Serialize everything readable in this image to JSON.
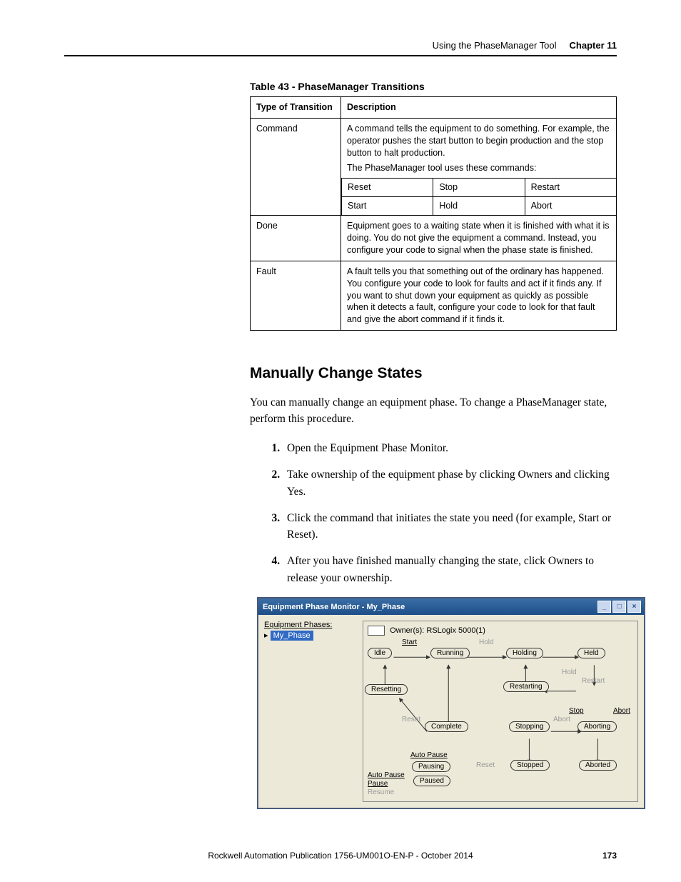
{
  "header": {
    "section": "Using the PhaseManager Tool",
    "chapter": "Chapter 11"
  },
  "table": {
    "caption": "Table 43 - PhaseManager Transitions",
    "head": {
      "c1": "Type of Transition",
      "c2": "Description"
    },
    "rows": {
      "command": {
        "type": "Command",
        "p1": "A command tells the equipment to do something. For example, the operator pushes the start button to begin production and the stop button to halt production.",
        "p2": "The PhaseManager tool uses these commands:",
        "cmds": [
          "Reset",
          "Stop",
          "Restart",
          "Start",
          "Hold",
          "Abort"
        ]
      },
      "done": {
        "type": "Done",
        "desc": "Equipment goes to a waiting state when it is finished with what it is doing. You do not give the equipment a command. Instead, you configure your code to signal when the phase state is finished."
      },
      "fault": {
        "type": "Fault",
        "desc": "A fault tells you that something out of the ordinary has happened. You configure your code to look for faults and act if it finds any. If you want to shut down your equipment as quickly as possible when it detects a fault, configure your code to look for that fault and give the abort command if it finds it."
      }
    }
  },
  "subhead": "Manually Change States",
  "intro": "You can manually change an equipment phase. To change a PhaseManager state, perform this procedure.",
  "steps": [
    "Open the Equipment Phase Monitor.",
    "Take ownership of the equipment phase by clicking Owners and clicking Yes.",
    "Click the command that initiates the state you need (for example, Start or Reset).",
    "After you have finished manually changing the state, click Owners to release your ownership."
  ],
  "window": {
    "title": "Equipment Phase Monitor - My_Phase",
    "tree_label": "Equipment Phases:",
    "tree_item": "My_Phase",
    "owners": "Owner(s): RSLogix 5000(1)",
    "states": {
      "idle": "Idle",
      "running": "Running",
      "holding": "Holding",
      "held": "Held",
      "resetting": "Resetting",
      "restarting": "Restarting",
      "complete": "Complete",
      "stopping": "Stopping",
      "aborting": "Aborting",
      "stopped": "Stopped",
      "aborted": "Aborted",
      "pausing": "Pausing",
      "paused": "Paused"
    },
    "cmds": {
      "start": "Start",
      "hold": "Hold",
      "hold2": "Hold",
      "restart": "Restart",
      "reset": "Reset",
      "stop": "Stop",
      "abort": "Abort",
      "abort2": "Abort",
      "reset2": "Reset",
      "autopause": "Auto Pause",
      "autopause2": "Auto Pause",
      "pause": "Pause",
      "resume": "Resume"
    }
  },
  "footer": {
    "pub": "Rockwell Automation Publication 1756-UM001O-EN-P - October 2014",
    "page": "173"
  }
}
